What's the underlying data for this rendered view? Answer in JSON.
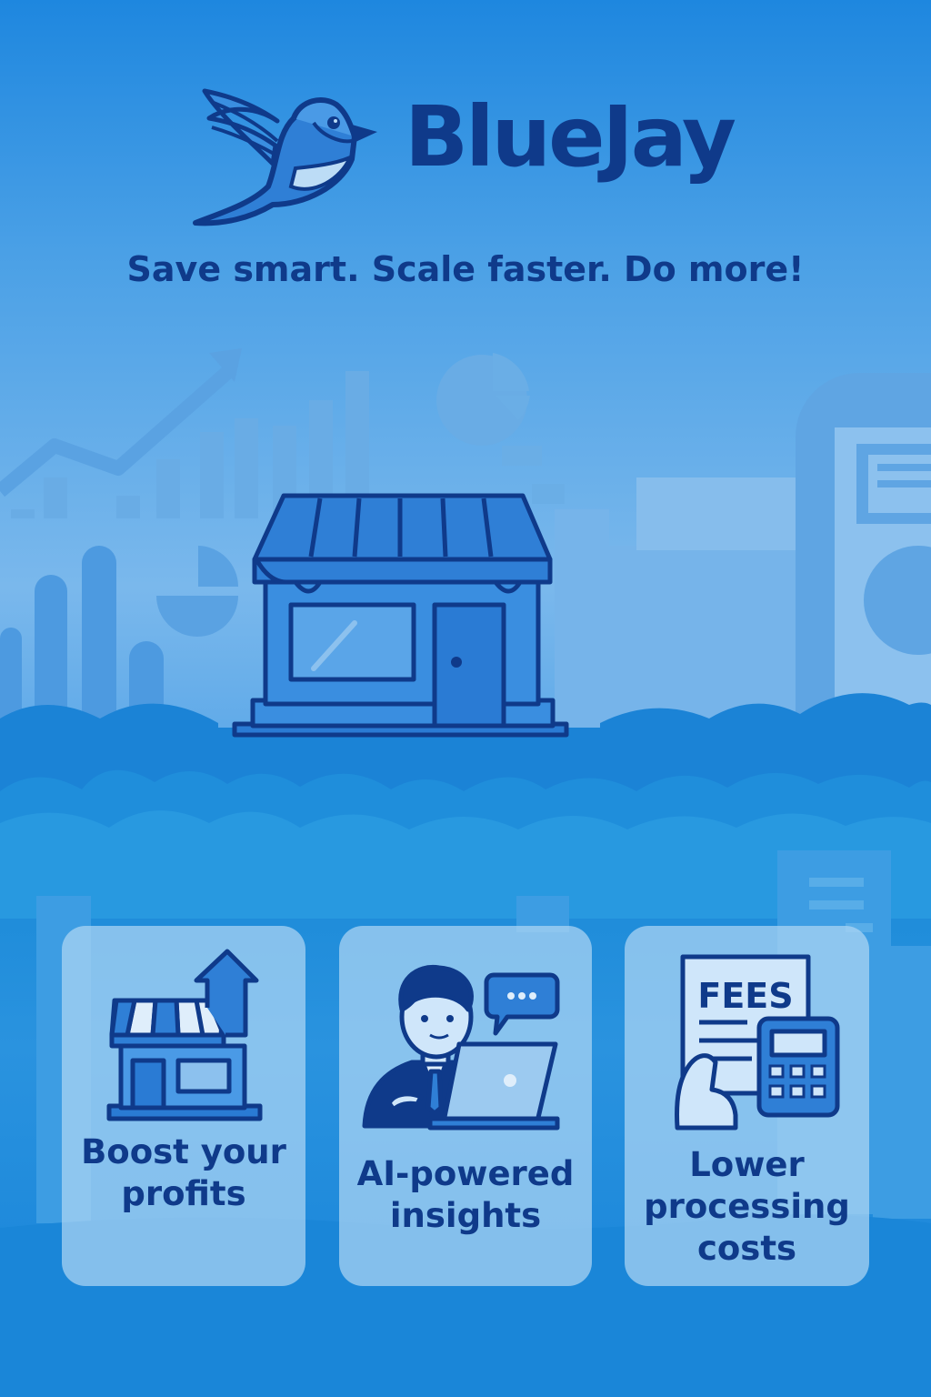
{
  "brand": {
    "name": "BlueJay",
    "logo_icon": "bluejay-bird-icon"
  },
  "tagline": "Save smart. Scale faster. Do more!",
  "hero": {
    "icon": "storefront-icon"
  },
  "features": [
    {
      "label": "Boost your\nprofits",
      "icon": "store-growth-icon"
    },
    {
      "label": "AI-powered\ninsights",
      "icon": "advisor-laptop-icon"
    },
    {
      "label": "Lower\nprocessing\ncosts",
      "icon": "fees-calculator-icon"
    }
  ],
  "colors": {
    "navy": "#0f3a8a",
    "brand_blue": "#1e87df",
    "card_fill": "#add5f4"
  }
}
